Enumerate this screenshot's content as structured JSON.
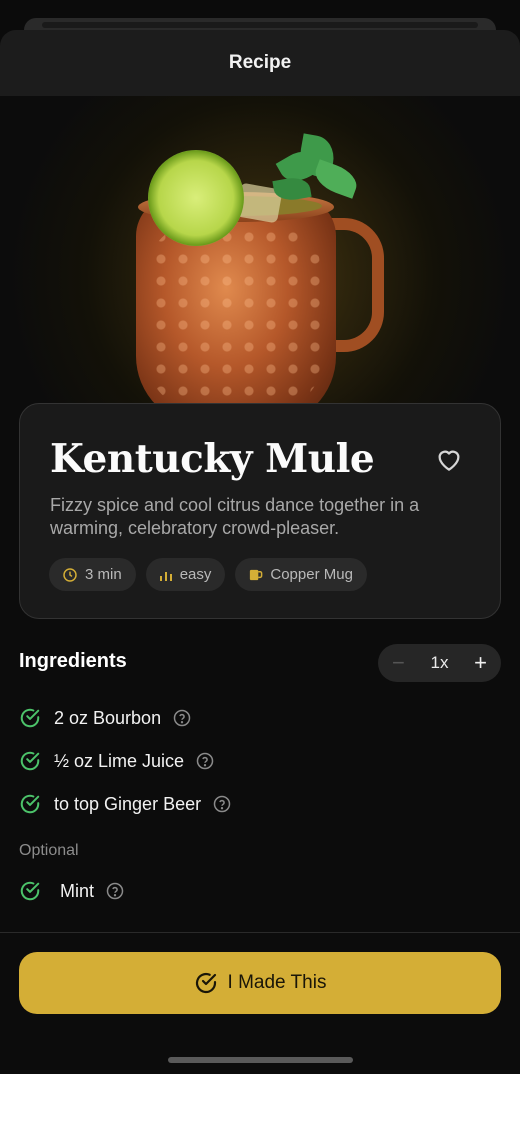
{
  "header": {
    "title": "Recipe"
  },
  "recipe": {
    "name": "Kentucky Mule",
    "description": "Fizzy spice and cool citrus dance together in a warming, celebratory crowd-pleaser.",
    "favorited": false,
    "tags": [
      {
        "icon": "clock-icon",
        "label": "3 min"
      },
      {
        "icon": "difficulty-bars-icon",
        "label": "easy"
      },
      {
        "icon": "mug-icon",
        "label": "Copper Mug"
      }
    ]
  },
  "ingredients": {
    "heading": "Ingredients",
    "multiplier": "1x",
    "items": [
      {
        "text": "2 oz Bourbon",
        "checked": true
      },
      {
        "text": "½ oz Lime Juice",
        "checked": true
      },
      {
        "text": "to top Ginger Beer",
        "checked": true
      }
    ],
    "optional_label": "Optional",
    "optional_items": [
      {
        "text": "Mint",
        "checked": true
      }
    ]
  },
  "cta": {
    "label": "I Made This",
    "icon": "check-circle-icon"
  },
  "colors": {
    "accent": "#d4ae36",
    "check": "#4cc36a",
    "background": "#0c0c0c",
    "card": "#1a1a1a"
  }
}
